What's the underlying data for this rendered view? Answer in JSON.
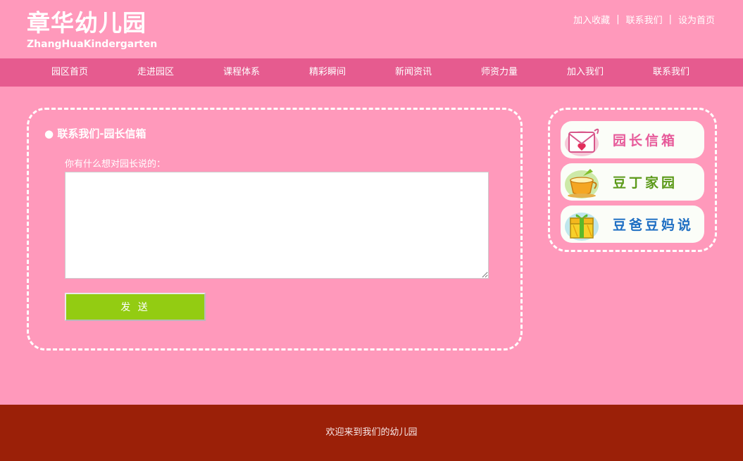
{
  "brand": {
    "name_cn": "章华幼儿园",
    "name_en": "ZhangHuaKindergarten"
  },
  "toplinks": [
    "加入收藏",
    "联系我们",
    "设为首页"
  ],
  "nav": [
    "园区首页",
    "走进园区",
    "课程体系",
    "精彩瞬间",
    "新闻资讯",
    "师资力量",
    "加入我们",
    "联系我们"
  ],
  "main": {
    "title": "联系我们-园长信箱",
    "prompt": "你有什么想对园长说的：",
    "message_value": "",
    "send_label": "发 送"
  },
  "sidebar": {
    "items": [
      {
        "label": "园长信箱",
        "icon": "envelope-heart-icon",
        "color": "#e75a9a"
      },
      {
        "label": "豆丁家园",
        "icon": "teacup-icon",
        "color": "#5c9a1a"
      },
      {
        "label": "豆爸豆妈说",
        "icon": "gift-box-icon",
        "color": "#1f6fc3"
      }
    ]
  },
  "footer": {
    "text": "欢迎来到我们的幼儿园"
  },
  "colors": {
    "background": "#ff99bb",
    "nav": "#e65b8f",
    "button": "#93cc12",
    "footer": "#9b2008"
  }
}
